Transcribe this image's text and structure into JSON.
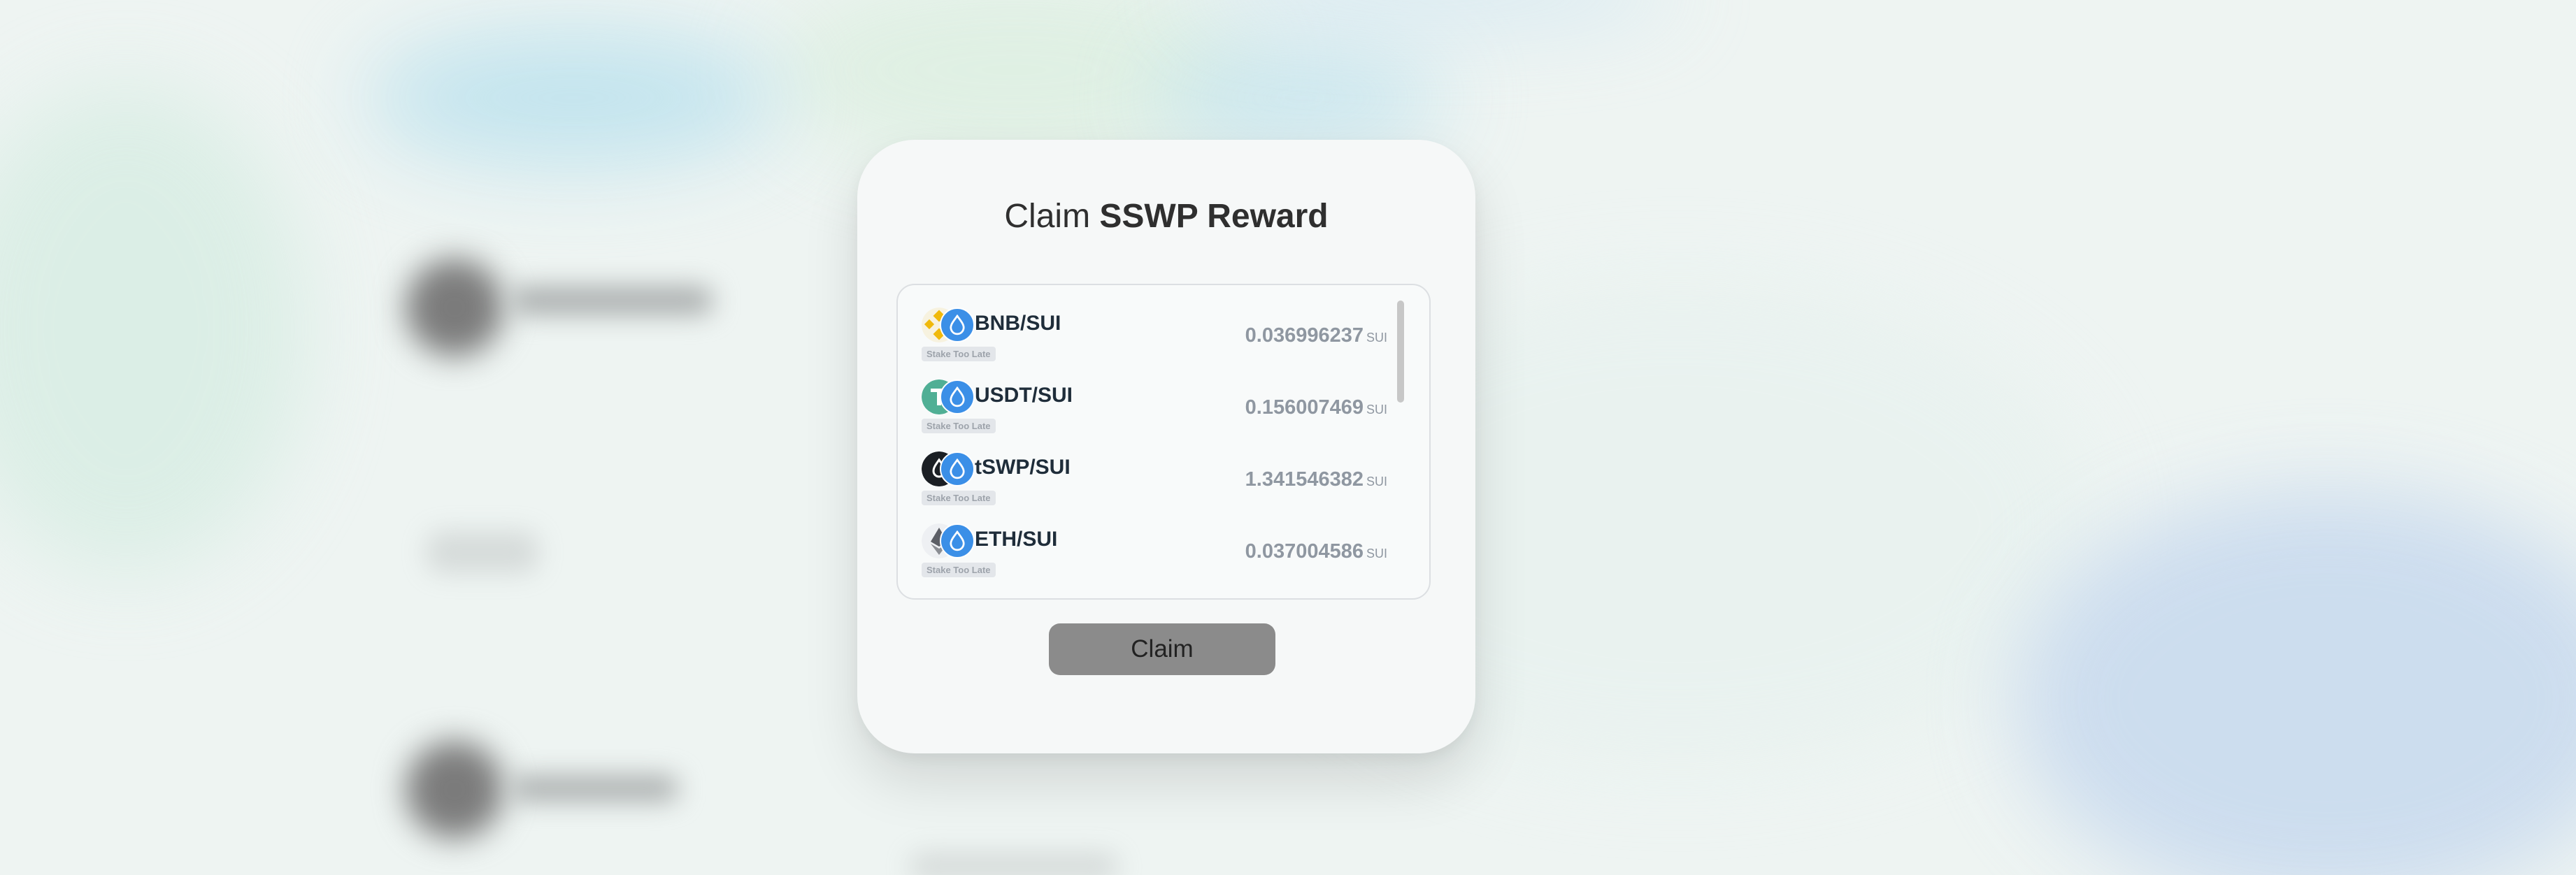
{
  "modal": {
    "title_prefix": "Claim",
    "title_strong": "SSWP Reward",
    "claim_button": "Claim"
  },
  "rewards": [
    {
      "pair": "BNB/SUI",
      "badge": "Stake Too Late",
      "amount": "0.036996237",
      "unit": "SUI",
      "icon_a": "bnb-icon",
      "icon_b": "sui-icon"
    },
    {
      "pair": "USDT/SUI",
      "badge": "Stake Too Late",
      "amount": "0.156007469",
      "unit": "SUI",
      "icon_a": "usdt-icon",
      "icon_b": "sui-icon"
    },
    {
      "pair": "tSWP/SUI",
      "badge": "Stake Too Late",
      "amount": "1.341546382",
      "unit": "SUI",
      "icon_a": "tswp-icon",
      "icon_b": "sui-icon"
    },
    {
      "pair": "ETH/SUI",
      "badge": "Stake Too Late",
      "amount": "0.037004586",
      "unit": "SUI",
      "icon_a": "eth-icon",
      "icon_b": "sui-icon"
    }
  ],
  "colors": {
    "claim_button_bg": "#8b8b8b",
    "sui_blue": "#3b8fe7",
    "bnb_yellow": "#f0b90b",
    "usdt_green": "#50af95"
  }
}
